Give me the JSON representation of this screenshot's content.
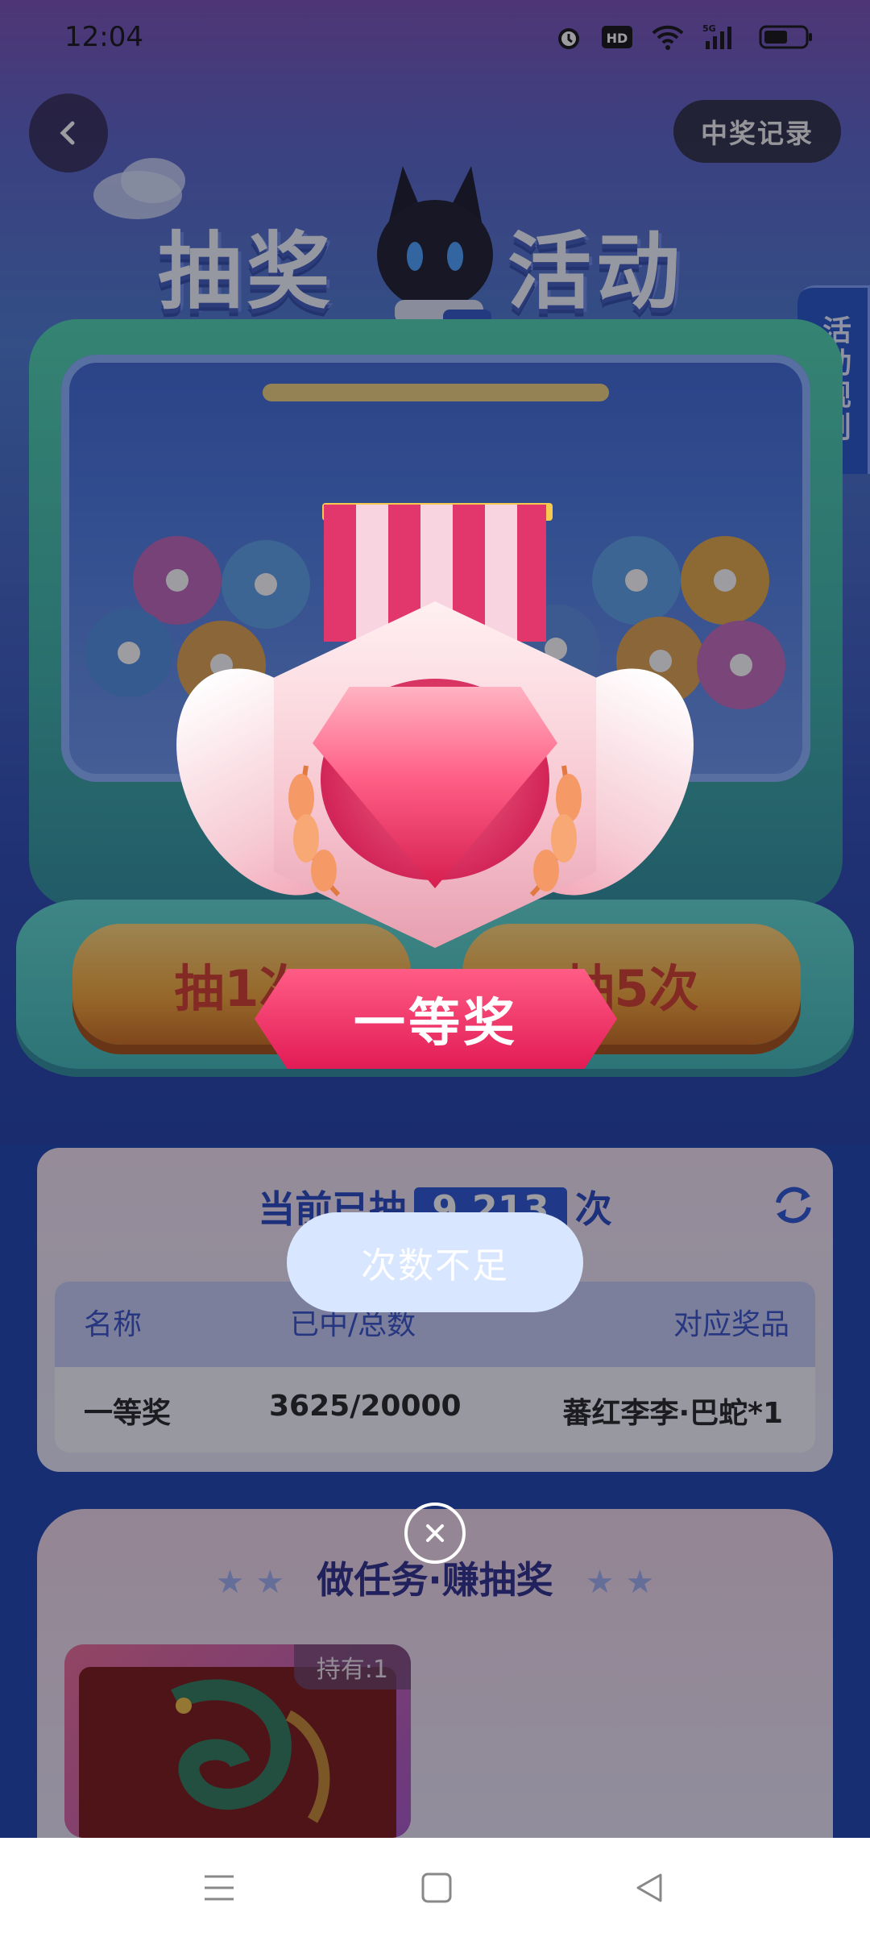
{
  "status_bar": {
    "time": "12:04"
  },
  "header": {
    "prize_record_label": "中奖记录",
    "title_left": "抽奖",
    "title_right": "活动"
  },
  "rules_tab": {
    "label": "活动规则"
  },
  "machine": {
    "draw_once_label": "抽1次",
    "draw_five_label": "抽5次"
  },
  "prize_popup": {
    "prize_name": "一等奖"
  },
  "stats": {
    "prefix": "当前已抽",
    "count": "9,213",
    "suffix": "次",
    "columns": [
      "名称",
      "已中/总数",
      "对应奖品"
    ],
    "rows": [
      {
        "name": "一等奖",
        "ratio": "3625/20000",
        "reward": "蕃红李李·巴蛇*1"
      }
    ]
  },
  "toast": {
    "message": "次数不足"
  },
  "tasks": {
    "title": "做任务·赚抽奖",
    "holdings": "持有:1"
  },
  "colors": {
    "accent_blue": "#2a54d4",
    "banner_red": "#e21b55",
    "gold": "#f5a532"
  }
}
